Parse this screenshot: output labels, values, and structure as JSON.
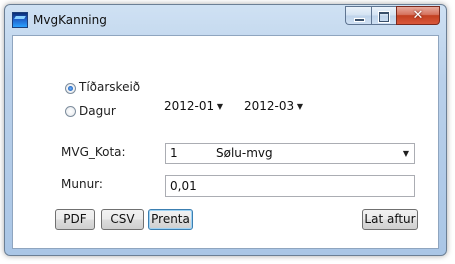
{
  "window": {
    "title": "MvgKanning",
    "close_glyph": "✕"
  },
  "mode": {
    "option_period": "Tíðarskeið",
    "option_day": "Dagur",
    "selected": "Tíðarskeið"
  },
  "period": {
    "from": "2012-01",
    "to": "2012-03"
  },
  "vat_code": {
    "label": "MVG_Kota:",
    "code": "1",
    "name": "Sølu-mvg"
  },
  "difference": {
    "label": "Munur:",
    "value": "0,01"
  },
  "buttons": {
    "pdf": "PDF",
    "csv": "CSV",
    "print": "Prenta",
    "close": "Lat aftur"
  },
  "icons": {
    "dropdown": "▼"
  }
}
